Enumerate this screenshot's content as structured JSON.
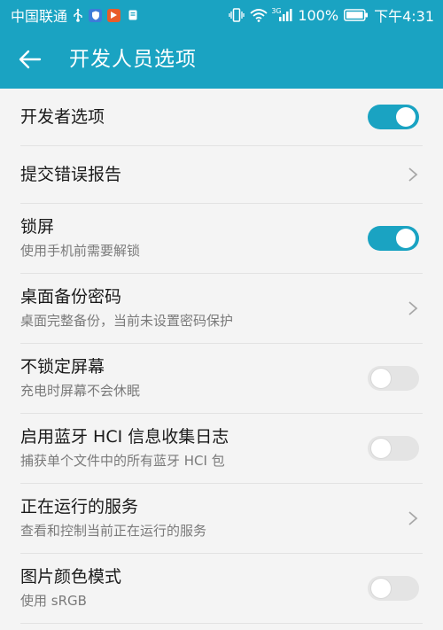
{
  "status_bar": {
    "carrier": "中国联通",
    "battery_percent": "100%",
    "time": "下午4:31",
    "network_type": "3G"
  },
  "app_bar": {
    "title": "开发人员选项"
  },
  "settings": [
    {
      "title": "开发者选项",
      "control": "toggle",
      "enabled": true
    },
    {
      "title": "提交错误报告",
      "control": "chevron"
    },
    {
      "title": "锁屏",
      "subtitle": "使用手机前需要解锁",
      "control": "toggle",
      "enabled": true
    },
    {
      "title": "桌面备份密码",
      "subtitle": "桌面完整备份，当前未设置密码保护",
      "control": "chevron"
    },
    {
      "title": "不锁定屏幕",
      "subtitle": "充电时屏幕不会休眠",
      "control": "toggle",
      "enabled": false
    },
    {
      "title": "启用蓝牙 HCI 信息收集日志",
      "subtitle": "捕获单个文件中的所有蓝牙 HCI 包",
      "control": "toggle",
      "enabled": false
    },
    {
      "title": "正在运行的服务",
      "subtitle": "查看和控制当前正在运行的服务",
      "control": "chevron"
    },
    {
      "title": "图片颜色模式",
      "subtitle": "使用 sRGB",
      "control": "toggle",
      "enabled": false
    }
  ],
  "colors": {
    "accent": "#1aa3c2",
    "toggle_off": "#e4e4e4",
    "background": "#f4f4f4",
    "divider": "#e2e2e2"
  }
}
